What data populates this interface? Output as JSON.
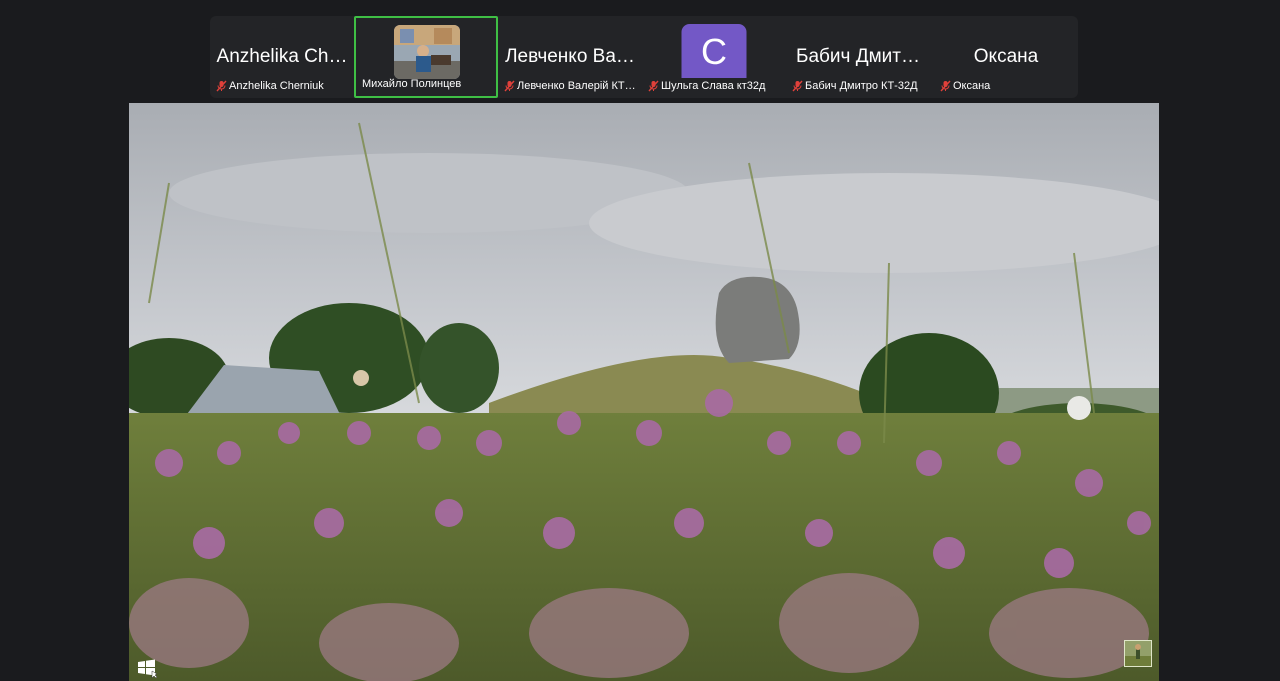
{
  "participants": [
    {
      "display": "Anzhelika Ch…",
      "label": "Anzhelika Cherniuk",
      "muted": true,
      "active": false,
      "video": false
    },
    {
      "display": "",
      "label": "Михайло Полинцев",
      "muted": false,
      "active": true,
      "video": true
    },
    {
      "display": "Левченко Ва…",
      "label": "Левченко Валерій КТ…",
      "muted": true,
      "active": false,
      "video": false
    },
    {
      "display": "",
      "avatar_letter": "C",
      "label": "Шульга Слава кт32д",
      "muted": true,
      "active": false,
      "video": false
    },
    {
      "display": "Бабич Дмит…",
      "label": "Бабич Дмитро КТ-32Д",
      "muted": true,
      "active": false,
      "video": false
    },
    {
      "display": "Оксана",
      "label": "Оксана",
      "muted": true,
      "active": false,
      "video": false
    }
  ],
  "colors": {
    "active_border": "#3fbf45",
    "avatar_bg": "#7358c6",
    "mic_muted": "#e0403a",
    "background": "#1a1b1e"
  },
  "icons": {
    "mute": "mic-muted-icon",
    "share_corner": "windows-logo-icon"
  }
}
